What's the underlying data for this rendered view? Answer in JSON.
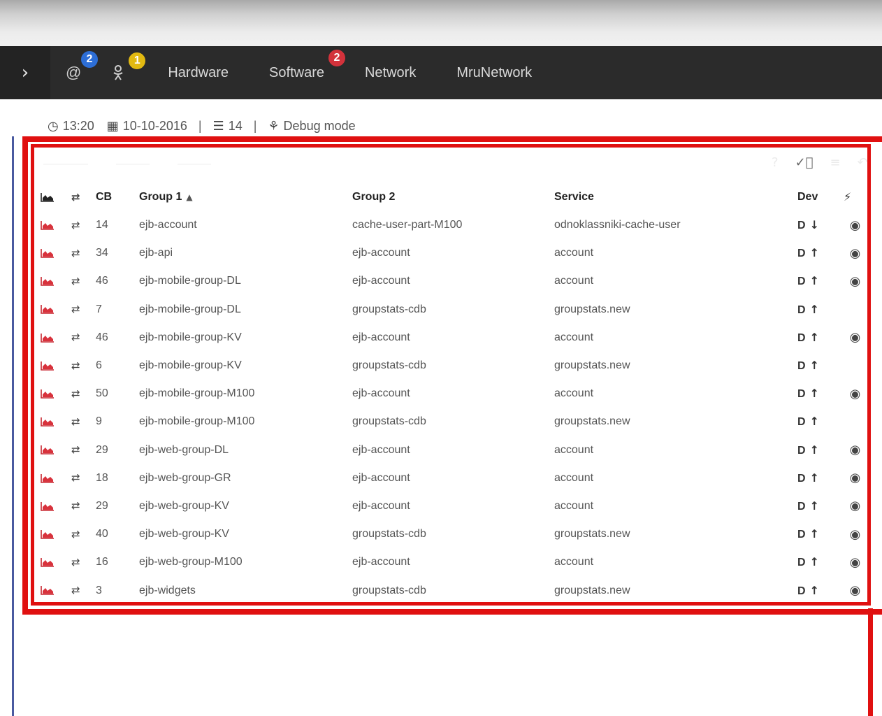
{
  "navbar": {
    "toggle_icon": "chevron-right-icon",
    "at_badge": "2",
    "ok_badge": "1",
    "links": [
      "Hardware",
      "Software",
      "Network",
      "MruNetwork"
    ],
    "software_badge": "2",
    "colors": {
      "bar": "#2b2b2b",
      "badge_blue": "#2d6ed6",
      "badge_yellow": "#e2b911",
      "badge_red": "#d3323b"
    }
  },
  "info": {
    "time": "13:20",
    "date": "10-10-2016",
    "count": "14",
    "mode": "Debug mode"
  },
  "table": {
    "headers": {
      "cb": "CB",
      "group1": "Group 1",
      "group2": "Group 2",
      "service": "Service",
      "dev": "Dev"
    },
    "highlight_color": "#e01010",
    "rows": [
      {
        "cb": "14",
        "group1": "ejb-account",
        "group2": "cache-user-part-M100",
        "service": "odnoklassniki-cache-user",
        "dev": "D",
        "dir": "down",
        "action": true
      },
      {
        "cb": "34",
        "group1": "ejb-api",
        "group2": "ejb-account",
        "service": "account",
        "dev": "D",
        "dir": "up",
        "action": true
      },
      {
        "cb": "46",
        "group1": "ejb-mobile-group-DL",
        "group2": "ejb-account",
        "service": "account",
        "dev": "D",
        "dir": "up",
        "action": true
      },
      {
        "cb": "7",
        "group1": "ejb-mobile-group-DL",
        "group2": "groupstats-cdb",
        "service": "groupstats.new",
        "dev": "D",
        "dir": "up",
        "action": false
      },
      {
        "cb": "46",
        "group1": "ejb-mobile-group-KV",
        "group2": "ejb-account",
        "service": "account",
        "dev": "D",
        "dir": "up",
        "action": true
      },
      {
        "cb": "6",
        "group1": "ejb-mobile-group-KV",
        "group2": "groupstats-cdb",
        "service": "groupstats.new",
        "dev": "D",
        "dir": "up",
        "action": false
      },
      {
        "cb": "50",
        "group1": "ejb-mobile-group-M100",
        "group2": "ejb-account",
        "service": "account",
        "dev": "D",
        "dir": "up",
        "action": true
      },
      {
        "cb": "9",
        "group1": "ejb-mobile-group-M100",
        "group2": "groupstats-cdb",
        "service": "groupstats.new",
        "dev": "D",
        "dir": "up",
        "action": false
      },
      {
        "cb": "29",
        "group1": "ejb-web-group-DL",
        "group2": "ejb-account",
        "service": "account",
        "dev": "D",
        "dir": "up",
        "action": true
      },
      {
        "cb": "18",
        "group1": "ejb-web-group-GR",
        "group2": "ejb-account",
        "service": "account",
        "dev": "D",
        "dir": "up",
        "action": true
      },
      {
        "cb": "29",
        "group1": "ejb-web-group-KV",
        "group2": "ejb-account",
        "service": "account",
        "dev": "D",
        "dir": "up",
        "action": true
      },
      {
        "cb": "40",
        "group1": "ejb-web-group-KV",
        "group2": "groupstats-cdb",
        "service": "groupstats.new",
        "dev": "D",
        "dir": "up",
        "action": true
      },
      {
        "cb": "16",
        "group1": "ejb-web-group-M100",
        "group2": "ejb-account",
        "service": "account",
        "dev": "D",
        "dir": "up",
        "action": true
      },
      {
        "cb": "3",
        "group1": "ejb-widgets",
        "group2": "groupstats-cdb",
        "service": "groupstats.new",
        "dev": "D",
        "dir": "up",
        "action": true
      }
    ]
  }
}
